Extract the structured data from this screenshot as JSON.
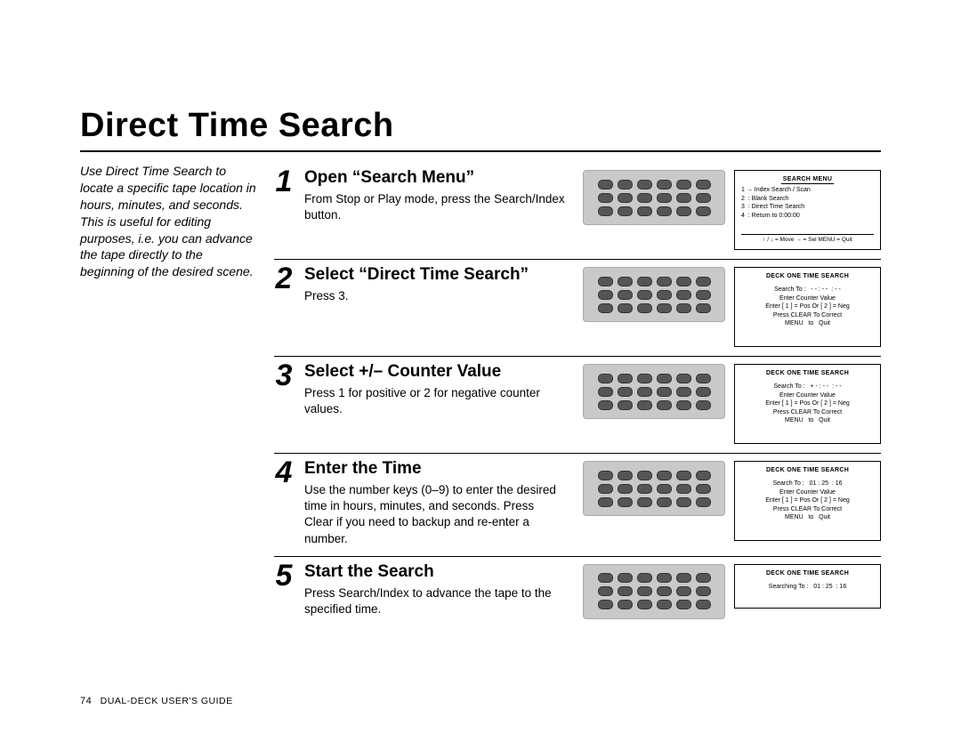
{
  "title": "Direct Time Search",
  "sidebar": "Use Direct Time Search to locate a specific tape location in hours, minutes, and seconds. This is useful for editing purposes, i.e. you can advance the tape directly to the beginning of the desired scene.",
  "steps": [
    {
      "num": "1",
      "title": "Open “Search Menu”",
      "body": "From Stop or Play mode, press the Search/Index button.",
      "osd": {
        "title": "SEARCH MENU",
        "lines": [
          "1 → Index Search / Scan",
          "2  : Blank Search",
          "3  : Direct Time Search",
          "4  : Return to 0:00:00"
        ],
        "footer": "↑ / ↓ = Move   → = Sel   MENU = Quit"
      }
    },
    {
      "num": "2",
      "title": "Select “Direct Time Search”",
      "body": "Press 3.",
      "osd": {
        "title": "DECK ONE TIME SEARCH",
        "centerLines": [
          "Search To :   - - : - -  : - -",
          "",
          "Enter Counter Value",
          "Enter [ 1 ] = Pos Or [ 2 ] = Neg",
          "Press CLEAR To Correct",
          "MENU   to   Quit"
        ]
      }
    },
    {
      "num": "3",
      "title": "Select +/– Counter Value",
      "body": "Press 1 for positive or 2 for negative counter values.",
      "osd": {
        "title": "DECK ONE TIME SEARCH",
        "centerLines": [
          "Search To :   + - : - -  : - -",
          "",
          "Enter Counter Value",
          "Enter [ 1 ] = Pos Or [ 2 ] = Neg",
          "Press CLEAR To Correct",
          "MENU   to   Quit"
        ]
      }
    },
    {
      "num": "4",
      "title": "Enter the Time",
      "body": "Use the number keys (0–9) to enter the desired time in hours, minutes, and seconds. Press Clear if you need to backup and re-enter a number.",
      "osd": {
        "title": "DECK ONE TIME SEARCH",
        "centerLines": [
          "Search To :   01 : 25  : 16",
          "",
          "Enter Counter Value",
          "Enter [ 1 ] = Pos Or [ 2 ] = Neg",
          "Press CLEAR To Correct",
          "MENU   to   Quit"
        ]
      }
    },
    {
      "num": "5",
      "title": "Start the Search",
      "body": "Press Search/Index to advance the tape to the specified time.",
      "osd": {
        "title": "DECK ONE TIME SEARCH",
        "short": true,
        "centerLines": [
          "Searching To :   01 : 25  : 16"
        ]
      }
    }
  ],
  "footer": {
    "page": "74",
    "label": "DUAL-DECK USER'S GUIDE"
  }
}
